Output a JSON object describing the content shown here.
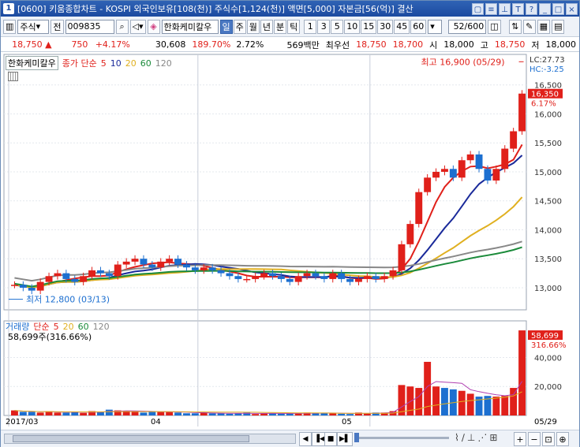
{
  "window": {
    "title": "[0600] 키움종합차트 - KOSPI 외국인보유[108(천)] 주식수[1,124(천)] 액면[5,000] 자본금[56(억)] 결산",
    "number": "1"
  },
  "toolbar": {
    "market": "주식",
    "prev_label": "전",
    "code": "009835",
    "stock_name": "한화케미칼우",
    "periods": [
      "일",
      "주",
      "월",
      "년",
      "분",
      "틱"
    ],
    "active_period": "일",
    "intervals": [
      "1",
      "3",
      "5",
      "10",
      "15",
      "30",
      "45",
      "60"
    ],
    "count": "52/600"
  },
  "infobar": {
    "price": "18,750 ▲",
    "change": "750",
    "change_pct": "+4.17%",
    "volume": "30,608",
    "volume_ratio": "189.70%",
    "turnover": "2.72%",
    "amount": "569백만",
    "ask_label": "최우선",
    "ask": "18,750",
    "bid": "18,700",
    "open_label": "시",
    "open": "18,000",
    "high_label": "고",
    "high": "18,750",
    "low_label": "저",
    "low": "18,000"
  },
  "price_panel": {
    "name": "한화케미칼우",
    "indicator": "종가 단순",
    "ma": [
      "5",
      "10",
      "20",
      "60",
      "120"
    ],
    "ma_colors": [
      "#e0201a",
      "#1a2a9a",
      "#e0b020",
      "#1a8a3a",
      "#888888"
    ],
    "lc": "LC:27.73",
    "hc": "HC:-3.25",
    "current_tag": "16,350",
    "current_pct": "6.17%",
    "high_note": "최고 16,900 (05/29)",
    "low_note": "최저 12,800 (03/13)",
    "y_ticks": [
      "16,500",
      "16,000",
      "15,500",
      "15,000",
      "14,500",
      "14,000",
      "13,500",
      "13,000"
    ]
  },
  "volume_panel": {
    "name": "거래량",
    "indicator": "단순",
    "ma": [
      "5",
      "20",
      "60",
      "120"
    ],
    "ma_colors": [
      "#e0201a",
      "#e0b020",
      "#1a8a3a",
      "#888888"
    ],
    "readout": "58,699주(316.66%)",
    "current_tag": "58,699",
    "current_pct": "316.66%",
    "y_ticks": [
      "40,000",
      "20,000"
    ]
  },
  "dates": [
    "2017/03",
    "04",
    "05",
    "05/29"
  ],
  "colors": {
    "up": "#e0201a",
    "down": "#1c6fd0",
    "accent": "#1c4aa0"
  },
  "chart_data": {
    "type": "candlestick",
    "x": [
      "03/02",
      "03/03",
      "03/06",
      "03/07",
      "03/08",
      "03/09",
      "03/10",
      "03/13",
      "03/14",
      "03/15",
      "03/16",
      "03/17",
      "03/20",
      "03/21",
      "03/22",
      "03/23",
      "03/24",
      "03/27",
      "03/28",
      "03/29",
      "03/30",
      "03/31",
      "04/03",
      "04/04",
      "04/05",
      "04/06",
      "04/07",
      "04/10",
      "04/11",
      "04/12",
      "04/13",
      "04/14",
      "04/17",
      "04/18",
      "04/19",
      "04/20",
      "04/21",
      "04/24",
      "04/25",
      "04/26",
      "04/27",
      "04/28",
      "05/01",
      "05/02",
      "05/04",
      "05/08",
      "05/10",
      "05/11",
      "05/12",
      "05/15",
      "05/16",
      "05/17",
      "05/18",
      "05/19",
      "05/22",
      "05/23",
      "05/24",
      "05/25",
      "05/26",
      "05/29"
    ],
    "close": [
      13050,
      13000,
      12950,
      13100,
      13200,
      13250,
      13150,
      13100,
      13200,
      13300,
      13250,
      13200,
      13400,
      13450,
      13500,
      13400,
      13350,
      13450,
      13500,
      13400,
      13350,
      13300,
      13350,
      13300,
      13250,
      13200,
      13150,
      13150,
      13200,
      13250,
      13200,
      13150,
      13100,
      13200,
      13250,
      13200,
      13150,
      13250,
      13150,
      13100,
      13150,
      13200,
      13150,
      13200,
      13300,
      13750,
      14100,
      14650,
      14900,
      15000,
      15050,
      14900,
      15200,
      15300,
      15050,
      14850,
      15050,
      15400,
      15700,
      16350
    ],
    "ma_series": [
      "5",
      "10",
      "20",
      "60",
      "120"
    ],
    "volume": [
      3500,
      2500,
      2500,
      2000,
      3000,
      2000,
      2000,
      2500,
      1800,
      3000,
      2500,
      4000,
      3500,
      3000,
      2500,
      2000,
      3000,
      2500,
      2500,
      2000,
      1500,
      1500,
      2000,
      1500,
      1500,
      1200,
      1500,
      2000,
      1000,
      1500,
      1500,
      1200,
      1500,
      1500,
      2000,
      1800,
      1500,
      1500,
      1200,
      1000,
      2000,
      1500,
      2000,
      2000,
      3000,
      21000,
      20000,
      19000,
      37000,
      20000,
      19000,
      18000,
      17000,
      15000,
      13000,
      13500,
      13000,
      13500,
      19000,
      58699
    ],
    "volume_up": [
      true,
      false,
      false,
      true,
      true,
      true,
      false,
      false,
      true,
      true,
      false,
      false,
      true,
      true,
      true,
      false,
      false,
      true,
      true,
      false,
      false,
      false,
      true,
      false,
      false,
      false,
      false,
      false,
      true,
      true,
      false,
      false,
      false,
      true,
      true,
      false,
      false,
      true,
      false,
      false,
      true,
      true,
      false,
      true,
      true,
      true,
      true,
      true,
      true,
      true,
      false,
      false,
      true,
      true,
      false,
      false,
      true,
      true,
      true,
      true
    ],
    "ylim": [
      12700,
      16700
    ],
    "volume_ylim": [
      0,
      62000
    ]
  }
}
